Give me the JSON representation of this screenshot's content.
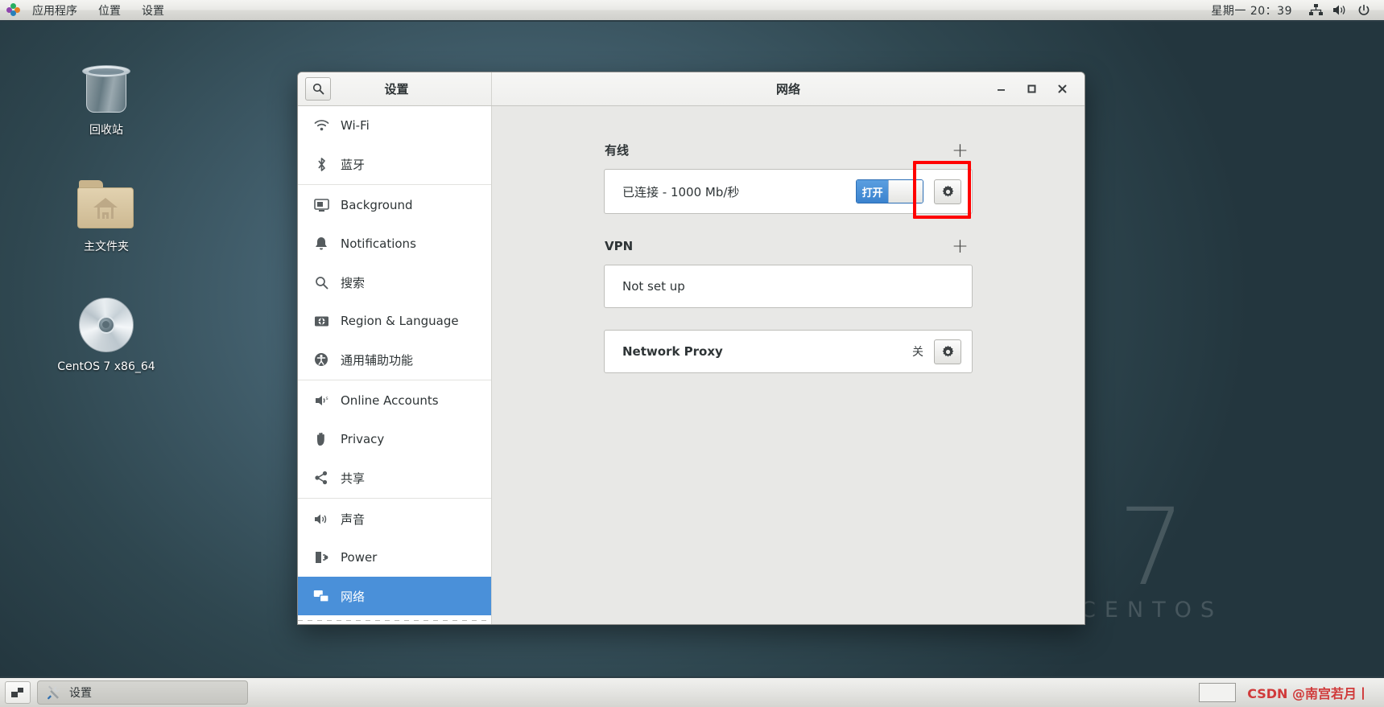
{
  "top_panel": {
    "menus": [
      "应用程序",
      "位置",
      "设置"
    ],
    "clock": "星期一 20：39",
    "tray_icons": [
      "network-icon",
      "volume-icon",
      "power-icon"
    ]
  },
  "desktop": {
    "icons": [
      {
        "name": "trash",
        "label": "回收站"
      },
      {
        "name": "home-folder",
        "label": "主文件夹"
      },
      {
        "name": "cdrom",
        "label": "CentOS 7 x86_64"
      }
    ],
    "watermark": {
      "number": "7",
      "word": "CENTOS"
    }
  },
  "window": {
    "sidebar_title": "设置",
    "title": "网络",
    "search_icon": "search-icon",
    "buttons": {
      "minimize": "—",
      "maximize": "□",
      "close": "✕"
    },
    "sidebar": {
      "items": [
        {
          "label": "Wi-Fi",
          "icon": "wifi-icon",
          "selected": false
        },
        {
          "label": "蓝牙",
          "icon": "bluetooth-icon",
          "selected": false
        },
        {
          "label": "Background",
          "icon": "background-icon",
          "selected": false
        },
        {
          "label": "Notifications",
          "icon": "bell-icon",
          "selected": false
        },
        {
          "label": "搜索",
          "icon": "search-icon",
          "selected": false
        },
        {
          "label": "Region & Language",
          "icon": "region-language-icon",
          "selected": false
        },
        {
          "label": "通用辅助功能",
          "icon": "accessibility-icon",
          "selected": false
        },
        {
          "label": "Online Accounts",
          "icon": "online-accounts-icon",
          "selected": false
        },
        {
          "label": "Privacy",
          "icon": "privacy-hand-icon",
          "selected": false
        },
        {
          "label": "共享",
          "icon": "sharing-icon",
          "selected": false
        },
        {
          "label": "声音",
          "icon": "sound-icon",
          "selected": false
        },
        {
          "label": "Power",
          "icon": "power-plug-icon",
          "selected": false
        },
        {
          "label": "网络",
          "icon": "network-icon",
          "selected": true
        }
      ]
    },
    "main": {
      "wired": {
        "title": "有线",
        "add_label": "+",
        "status": "已连接 - 1000 Mb/秒",
        "toggle_label": "打开",
        "toggle_state": "on",
        "gear": "gear-icon"
      },
      "vpn": {
        "title": "VPN",
        "add_label": "+",
        "status": "Not set up"
      },
      "proxy": {
        "title": "Network Proxy",
        "status": "关",
        "gear": "gear-icon"
      }
    },
    "annotation": {
      "shape": "rectangle",
      "color": "#ff0000",
      "targets": "wired-gear-button"
    }
  },
  "taskbar": {
    "show_desktop": "show-desktop-icon",
    "tasks": [
      {
        "label": "设置",
        "icon": "settings-tools-icon"
      }
    ],
    "workspace_switcher": "workspace-switcher",
    "credit": "CSDN @南宫若月丨"
  }
}
